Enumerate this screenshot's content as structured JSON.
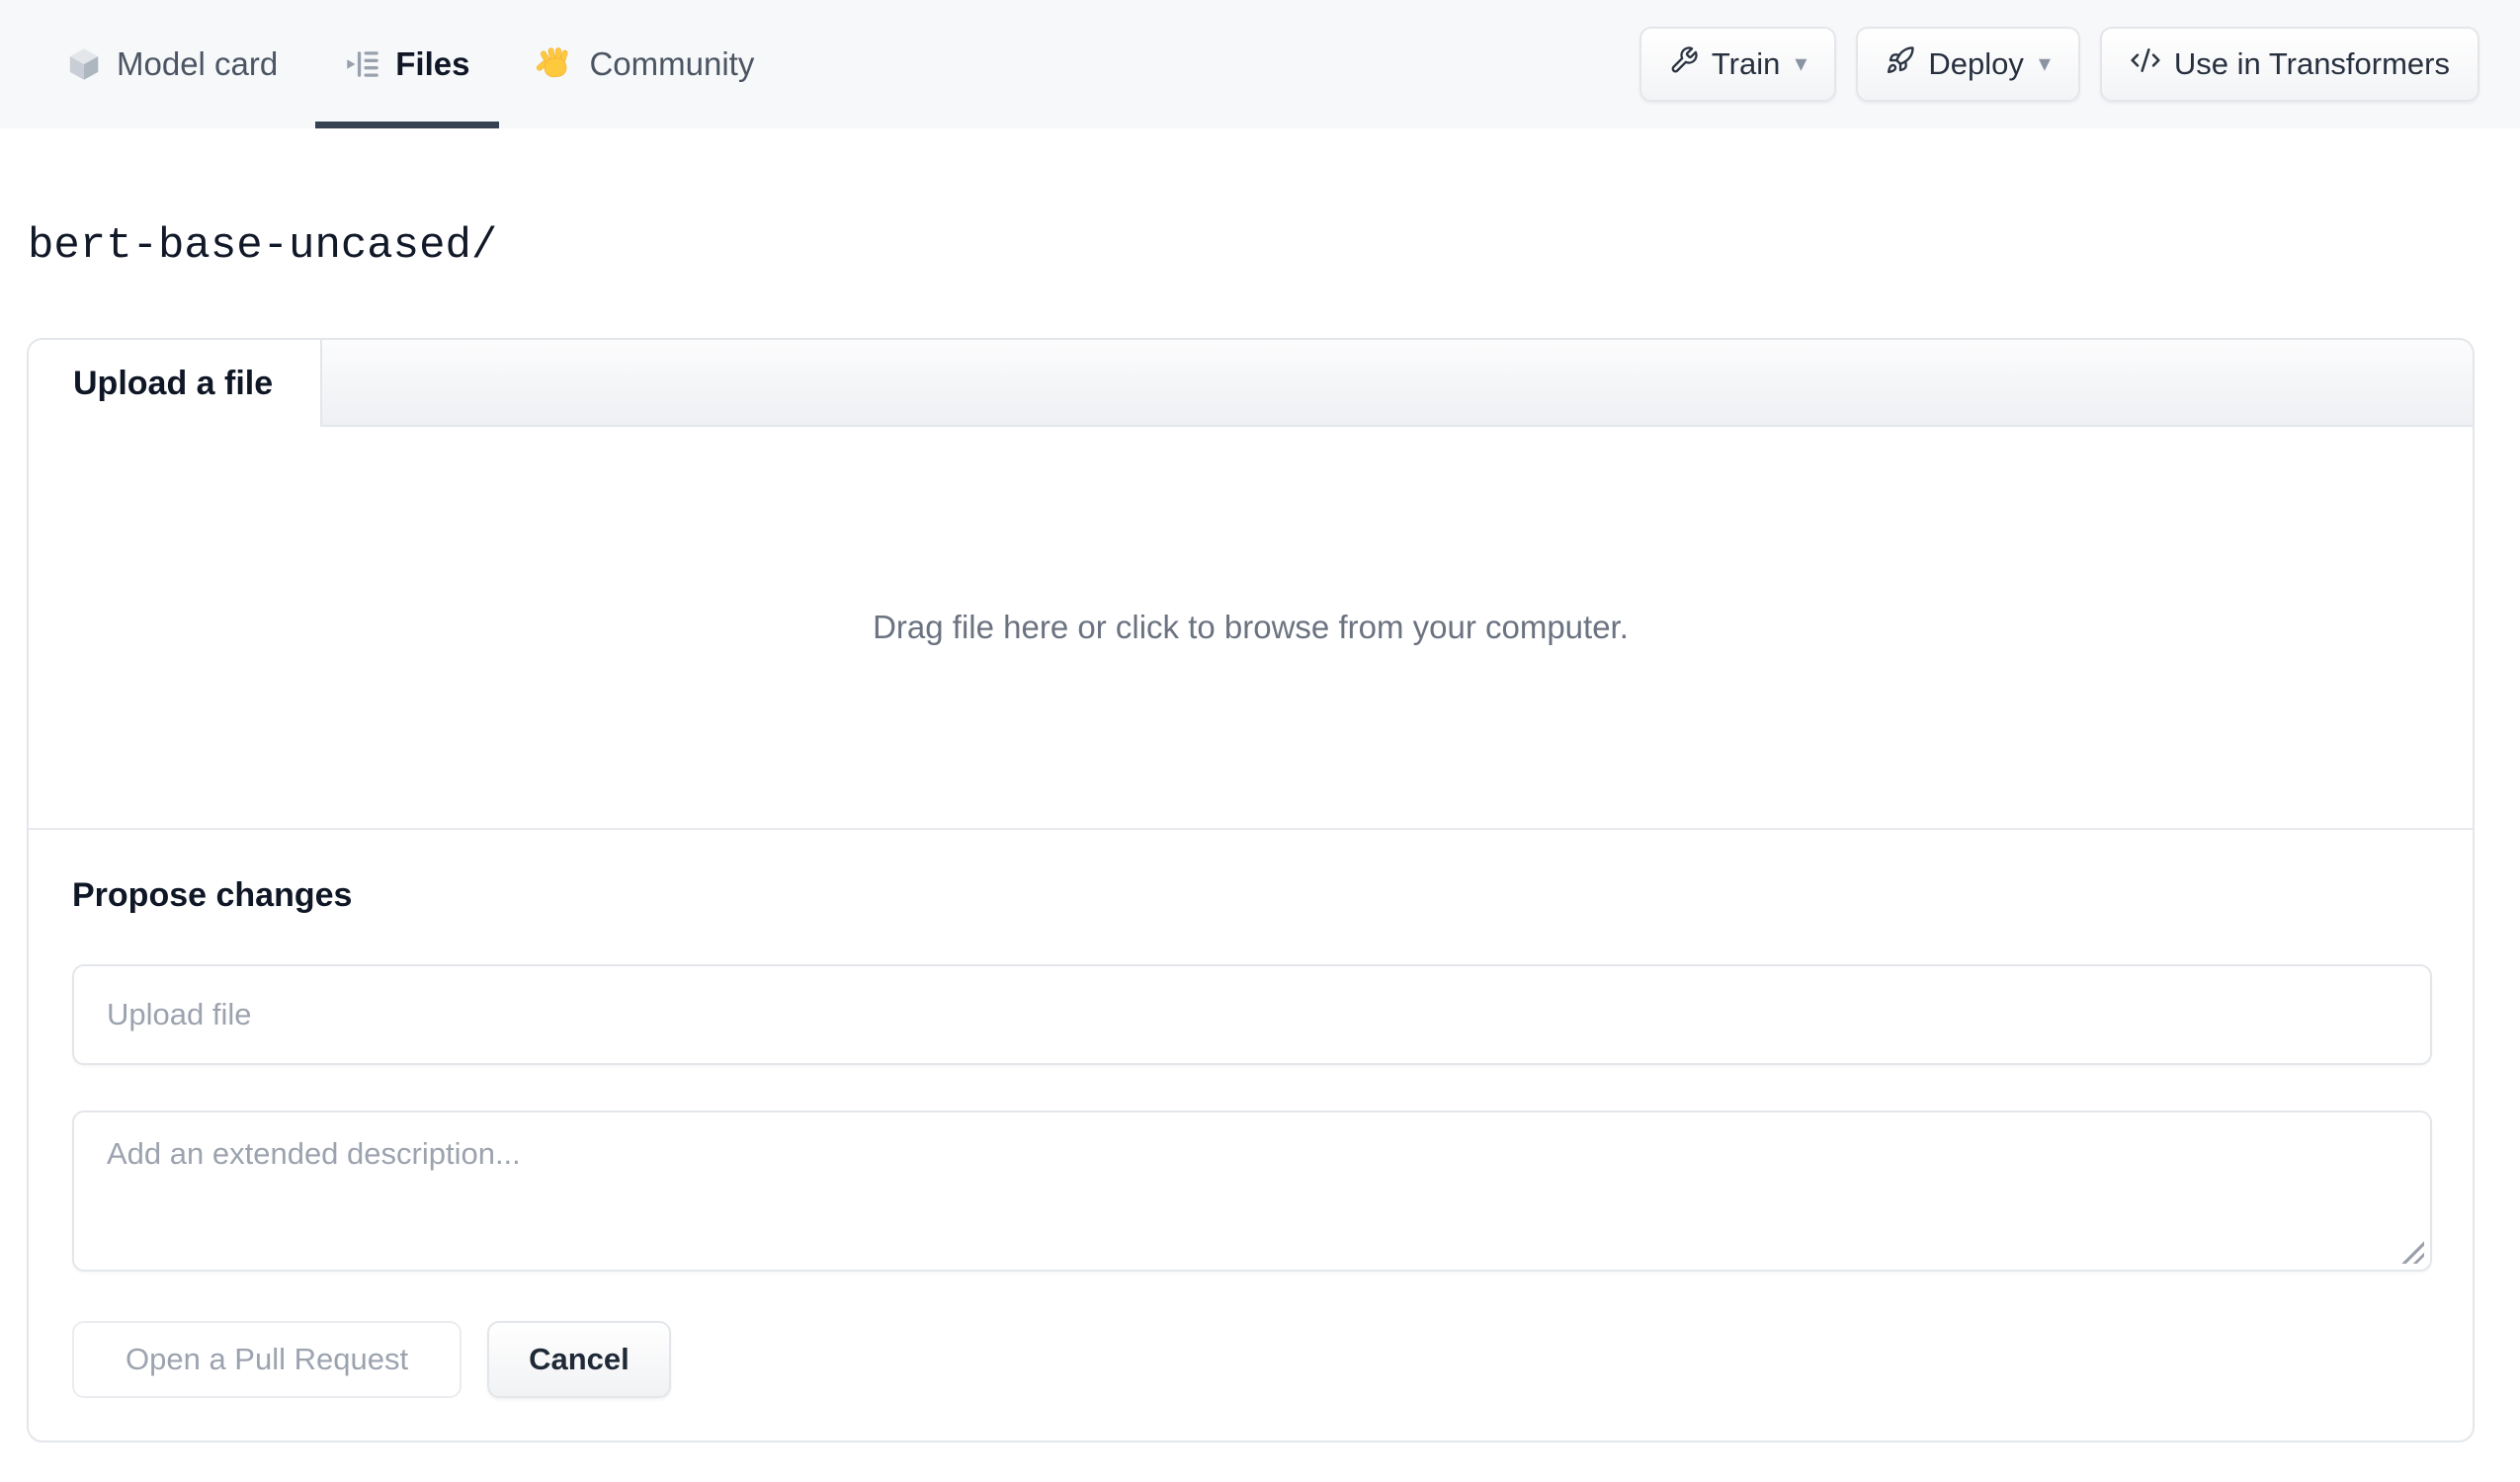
{
  "nav": {
    "tabs": [
      {
        "label": "Model card",
        "icon": "cube-icon",
        "active": false
      },
      {
        "label": "Files",
        "icon": "files-list-icon",
        "active": true
      },
      {
        "label": "Community",
        "icon": "waving-hand-icon",
        "active": false
      }
    ],
    "actions": [
      {
        "label": "Train",
        "icon": "wrench-icon",
        "has_dropdown": true
      },
      {
        "label": "Deploy",
        "icon": "rocket-icon",
        "has_dropdown": true
      },
      {
        "label": "Use in Transformers",
        "icon": "code-icon",
        "has_dropdown": false
      }
    ],
    "dropdown_caret": "▾"
  },
  "breadcrumb": {
    "repo_path": "bert-base-uncased/"
  },
  "upload_panel": {
    "tab_label": "Upload a file",
    "dropzone_text": "Drag file here or click to browse from your computer.",
    "propose": {
      "heading": "Propose changes",
      "file_input_placeholder": "Upload file",
      "description_placeholder": "Add an extended description...",
      "submit_label": "Open a Pull Request",
      "cancel_label": "Cancel"
    }
  },
  "colors": {
    "nav_background": "#f7f8fa",
    "active_tab_underline": "#364153",
    "text_primary": "#111827",
    "text_secondary": "#4b5563",
    "muted_text": "#9ca3af",
    "border": "#e3e6ea",
    "hand_yellow": "#ffc93e"
  }
}
